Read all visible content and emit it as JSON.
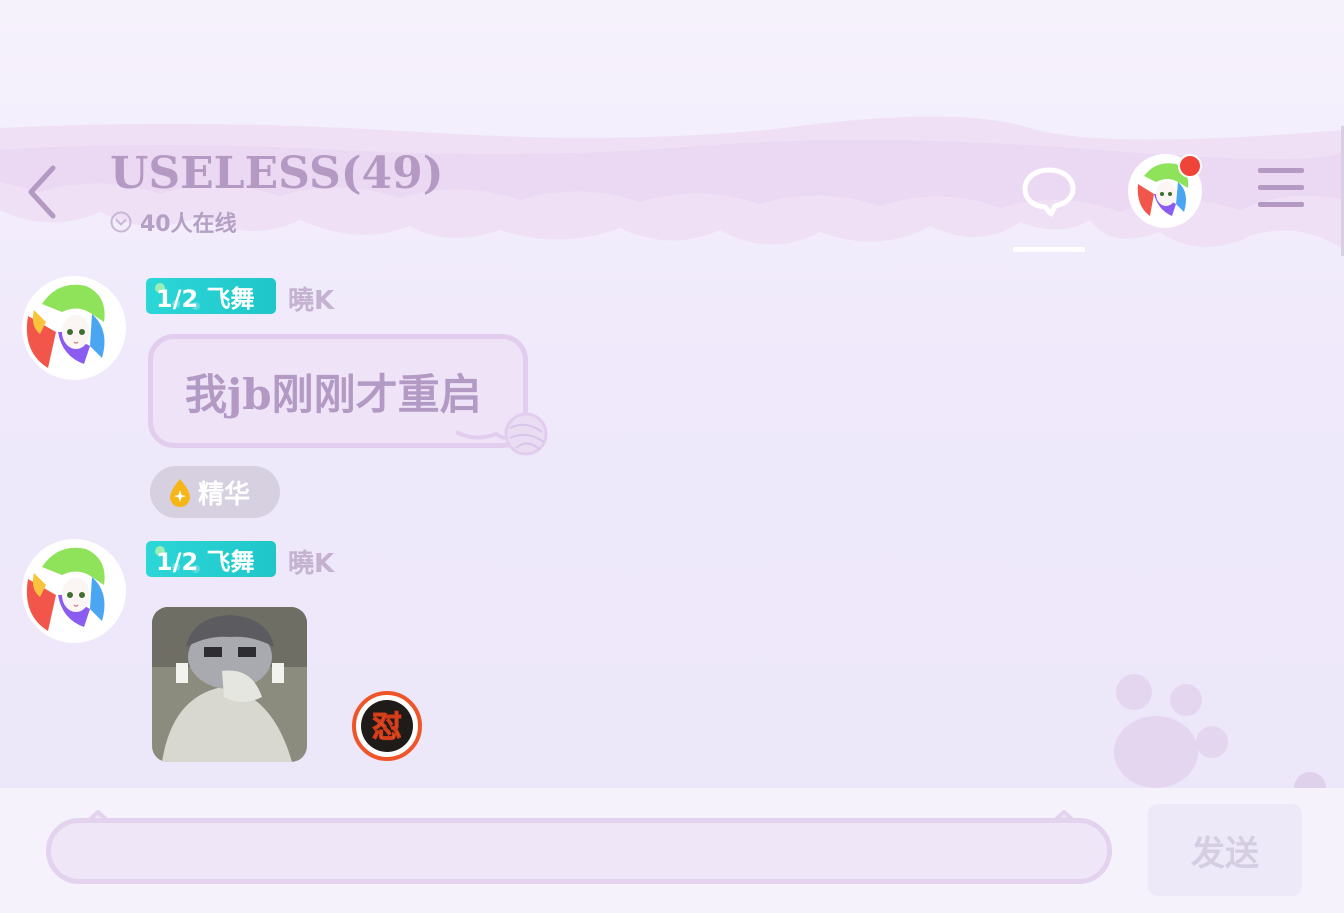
{
  "header": {
    "title": "USELESS(49)",
    "online_count": "40人在线",
    "icons": {
      "back": "chevron-left-icon",
      "chat": "chat-bubble-icon",
      "menu": "hamburger-menu-icon"
    },
    "notification_dot_color": "#f04438"
  },
  "messages": [
    {
      "badge": "1/2 飞舞",
      "username": "曉K",
      "text": "我jb刚刚才重启",
      "tag": "精华"
    },
    {
      "badge": "1/2 飞舞",
      "username": "曉K",
      "sticker": "grayscale-girl-sticker",
      "reaction": "怼"
    }
  ],
  "input": {
    "placeholder": "",
    "value": "",
    "send_label": "发送"
  },
  "colors": {
    "accent": "#b49ac2",
    "badge": "#2cd7d8",
    "bubble_border": "#e2cdee",
    "background": "#efe9fb"
  }
}
